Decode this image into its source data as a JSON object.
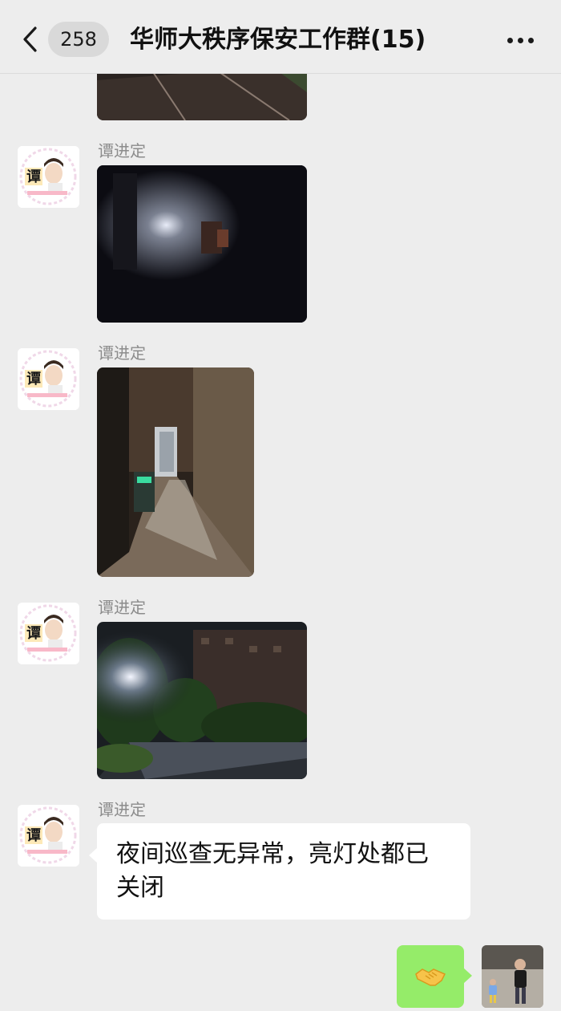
{
  "header": {
    "unread_count": "258",
    "title": "华师大秩序保安工作群(15)"
  },
  "avatar_badge_char": "谭",
  "messages": [
    {
      "sender": "谭进定",
      "type": "image"
    },
    {
      "sender": "谭进定",
      "type": "image"
    },
    {
      "sender": "谭进定",
      "type": "image"
    },
    {
      "sender": "谭进定",
      "type": "text",
      "text_line1": "夜间巡查无异常，亮灯处都已",
      "text_line2": "关闭"
    }
  ],
  "self_message": {
    "type": "emoji",
    "emoji": "🤝"
  },
  "colors": {
    "background": "#ededed",
    "self_bubble": "#95ec69",
    "other_bubble": "#ffffff",
    "sender_name": "#8c8c8c"
  }
}
